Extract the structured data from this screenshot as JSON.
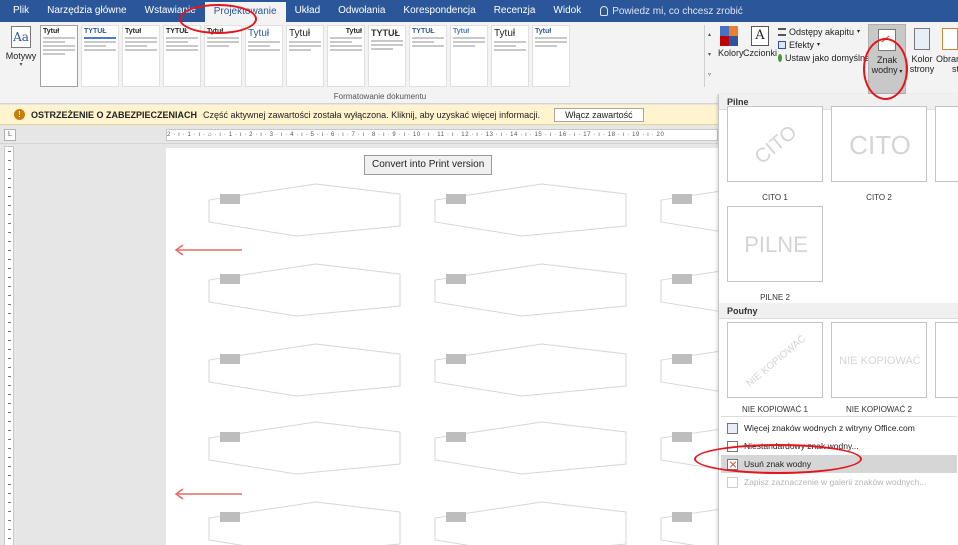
{
  "tabs": [
    "Plik",
    "Narzędzia główne",
    "Wstawianie",
    "Projektowanie",
    "Układ",
    "Odwołania",
    "Korespondencja",
    "Recenzja",
    "Widok"
  ],
  "active_tab": "Projektowanie",
  "tell_me": "Powiedz mi, co chcesz zrobić",
  "ribbon": {
    "motywy_label": "Motywy",
    "motywy_icon_text": "Aa",
    "style_titles": [
      "Tytuł",
      "TYTUŁ",
      "Tytuł",
      "TYTUŁ",
      "Tytuł",
      "Tytuł",
      "Tytuł",
      "Tytuł",
      "TYTUŁ",
      "TYTUŁ",
      "Tytuł",
      "Tytuł",
      "Tytuł"
    ],
    "section_label": "Formatowanie dokumentu",
    "kolory_label": "Kolory",
    "czcionki_label": "Czcionki",
    "czcionki_icon_text": "A",
    "odstepy_label": "Odstępy akapitu",
    "efekty_label": "Efekty",
    "ustaw_label": "Ustaw jako domyślne",
    "znak_line1": "Znak",
    "znak_line2": "wodny",
    "kolor_strony_line1": "Kolor",
    "kolor_strony_line2": "strony",
    "obramowania_line1": "Obran",
    "obramowania_line2": "st"
  },
  "warning": {
    "title": "OSTRZEŻENIE O ZABEZPIECZENIACH",
    "message": "Część aktywnej zawartości została wyłączona. Kliknij, aby uzyskać więcej informacji.",
    "button": "Włącz zawartość"
  },
  "ruler_text": "2 · ı · 1 · ı · ⌂ · ı · 1 · ı · 2 · ı · 3 · ı · 4 · ı · 5 · ı · 6 · ı · 7 · ı · 8 · ı · 9 · ı · 10 · ı · 11 · ı · 12 · ı · 13 · ı · 14 · ı · 15 · ı · 16 · ı · 17 · ı · 18 · ı · 19 · ı · 20",
  "ruler_corner": "L",
  "document": {
    "convert_button": "Convert into Print version"
  },
  "watermark_menu": {
    "section_pilne": "Pilne",
    "section_poufny": "Poufny",
    "thumbs": [
      {
        "text": "CITO",
        "caption": "CITO 1",
        "style": "diagonal"
      },
      {
        "text": "CITO",
        "caption": "CITO 2",
        "style": "horizontal"
      },
      {
        "text": "PILNE",
        "caption": "PILNE 2",
        "style": "horizontal"
      },
      {
        "text": "NIE KOPIOWAĆ",
        "caption": "NIE KOPIOWAĆ 1",
        "style": "diagonal"
      },
      {
        "text": "NIE KOPIOWAĆ",
        "caption": "NIE KOPIOWAĆ 2",
        "style": "horizontal"
      }
    ],
    "items": [
      {
        "label": "Więcej znaków wodnych z witryny Office.com",
        "enabled": true
      },
      {
        "label": "Niestandardowy znak wodny...",
        "enabled": true
      },
      {
        "label": "Usuń znak wodny",
        "enabled": true
      },
      {
        "label": "Zapisz zaznaczenie w galerii znaków wodnych...",
        "enabled": false
      }
    ]
  },
  "colors": {
    "tabbar": "#2b579a",
    "annotation": "#e2161c",
    "arrow": "#e86a6a"
  }
}
